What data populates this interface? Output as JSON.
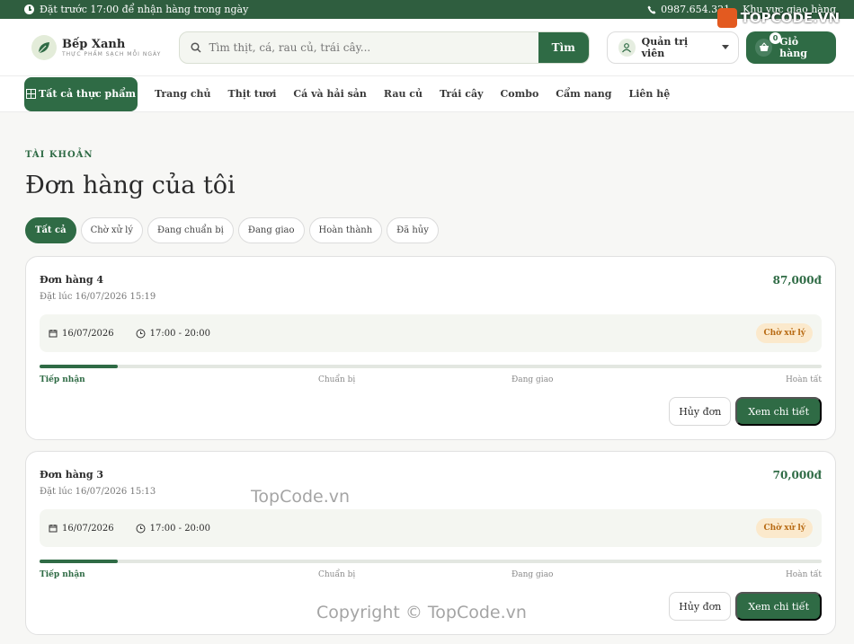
{
  "topbar": {
    "left_text": "Đặt trước 17:00 để nhận hàng trong ngày",
    "phone": "0987.654.321",
    "area": "Khu vực giao hàng"
  },
  "brand_watermark": "TOPCODE.VN",
  "header": {
    "logo_name": "Bếp Xanh",
    "logo_tagline": "THỰC PHẨM SẠCH MỖI NGÀY",
    "search_placeholder": "Tìm thịt, cá, rau củ, trái cây...",
    "search_button": "Tìm",
    "admin_label": "Quản trị viên",
    "cart_label": "Giỏ hàng",
    "cart_count": "0"
  },
  "nav": {
    "all_categories": "Tất cả thực phẩm",
    "links": [
      "Trang chủ",
      "Thịt tươi",
      "Cá và hải sản",
      "Rau củ",
      "Trái cây",
      "Combo",
      "Cẩm nang",
      "Liên hệ"
    ]
  },
  "page": {
    "breadcrumb": "TÀI KHOẢN",
    "title": "Đơn hàng của tôi",
    "tabs": [
      "Tất cả",
      "Chờ xử lý",
      "Đang chuẩn bị",
      "Đang giao",
      "Hoàn thành",
      "Đã hủy"
    ],
    "active_tab": "Tất cả"
  },
  "orders": [
    {
      "title": "Đơn hàng 4",
      "placed": "Đặt lúc 16/07/2026 15:19",
      "total": "87,000đ",
      "date": "16/07/2026",
      "time": "17:00 - 20:00",
      "status": "Chờ xử lý",
      "progress_percent": 10,
      "steps": [
        "Tiếp nhận",
        "Chuẩn bị",
        "Đang giao",
        "Hoàn tất"
      ],
      "cancel": "Hủy đơn",
      "detail": "Xem chi tiết"
    },
    {
      "title": "Đơn hàng 3",
      "placed": "Đặt lúc 16/07/2026 15:13",
      "total": "70,000đ",
      "date": "16/07/2026",
      "time": "17:00 - 20:00",
      "status": "Chờ xử lý",
      "progress_percent": 10,
      "steps": [
        "Tiếp nhận",
        "Chuẩn bị",
        "Đang giao",
        "Hoàn tất"
      ],
      "cancel": "Hủy đơn",
      "detail": "Xem chi tiết"
    }
  ],
  "watermarks": {
    "center": "TopCode.vn",
    "bottom": "Copyright © TopCode.vn"
  },
  "colors": {
    "primary": "#2f6b45",
    "topbar": "#2f5e3f",
    "status_bg": "#fbe9cc",
    "status_text": "#b86b14"
  }
}
